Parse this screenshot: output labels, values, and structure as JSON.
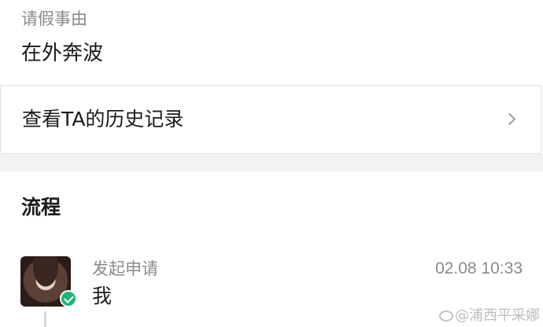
{
  "reason": {
    "label": "请假事由",
    "value": "在外奔波"
  },
  "history": {
    "label": "查看TA的历史记录",
    "chevron_icon": "chevron-right-icon"
  },
  "process": {
    "title": "流程",
    "steps": [
      {
        "name": "发起申请",
        "time": "02.08 10:33",
        "actor": "我",
        "status_icon": "check-circle-icon",
        "status_color": "#1fb47a"
      }
    ]
  },
  "watermark": {
    "text": "@浦西平采娜"
  }
}
